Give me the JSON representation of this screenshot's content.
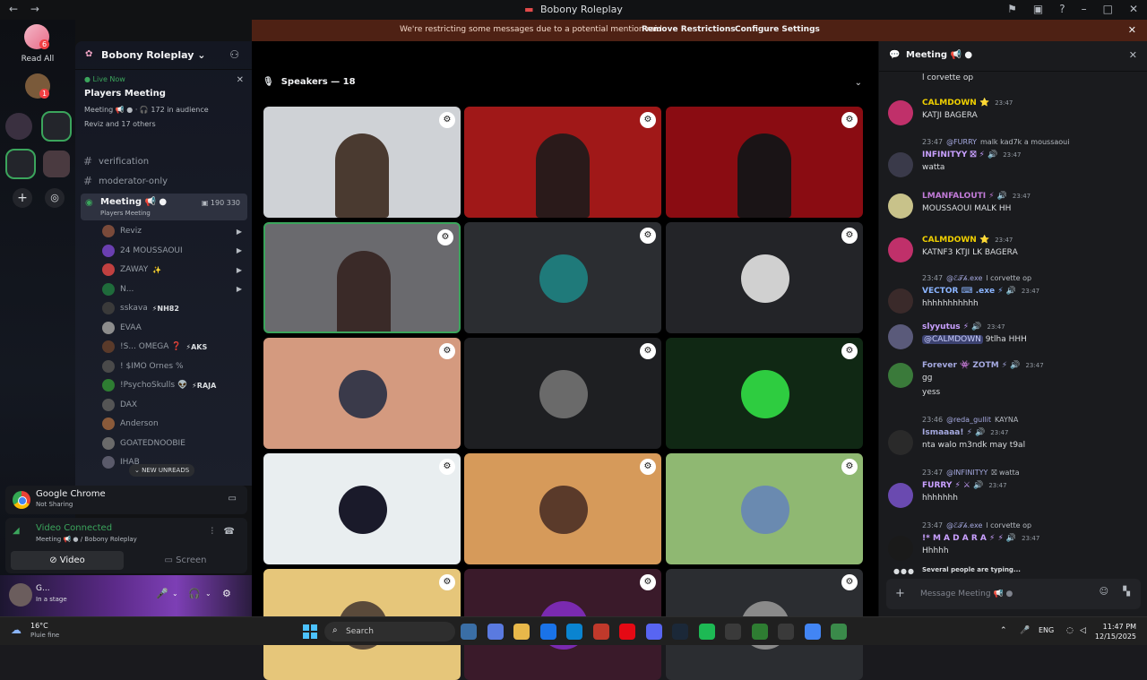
{
  "window": {
    "title": "Bobony Roleplay",
    "nav_back": "←",
    "nav_forward": "→",
    "tools": [
      "⚑",
      "▣",
      "?",
      "–",
      "□",
      "✕"
    ]
  },
  "rail": {
    "read_all_label": "Read All",
    "badges": [
      "6",
      "1"
    ]
  },
  "notice": {
    "message": "We're restricting some messages due to a potential mention raid",
    "link1": "Remove Restrictions",
    "link2": "Configure Settings"
  },
  "server": {
    "name": "Bobony Roleplay ⌄",
    "live": {
      "status": "● Live Now",
      "title": "Players Meeting",
      "sub": "Meeting 📢 ● · 🎧 172 in audience",
      "who": "Reviz and 17 others"
    },
    "channels": [
      "verification",
      "moderator-only"
    ],
    "active_channel": {
      "name": "Meeting 📢 ●",
      "sub": "Players Meeting",
      "counts": "▣ 190   330"
    },
    "voice_users": [
      {
        "name": "Reviz",
        "tag": "",
        "color": "#7a4a3a"
      },
      {
        "name": "24 MOUSSAOUI",
        "tag": "",
        "color": "#6a3fb0"
      },
      {
        "name": "ZAWAY",
        "tag": "✨",
        "color": "#c04040"
      },
      {
        "name": "N...",
        "tag": "",
        "color": "#1f6b3b"
      },
      {
        "name": "sskava",
        "tag": "⚡NH82",
        "color": "#3a3a3a"
      },
      {
        "name": "EVAA",
        "tag": "",
        "color": "#8d8d8d"
      },
      {
        "name": "!S... OMEGA ❓",
        "tag": "⚡AKS",
        "color": "#5a3a2a"
      },
      {
        "name": "! $IMO Ornes %",
        "tag": "",
        "color": "#4a4a4a"
      },
      {
        "name": "!PsychoSkulls 👽",
        "tag": "⚡RAJA",
        "color": "#2e7d32"
      },
      {
        "name": "DAX",
        "tag": "",
        "color": "#555"
      },
      {
        "name": "Anderson",
        "tag": "",
        "color": "#8a5a3a"
      },
      {
        "name": "GOATEDNOOBIE",
        "tag": "",
        "color": "#6a6a6a"
      },
      {
        "name": "IHAB",
        "tag": "",
        "color": "#5a5a6a"
      }
    ],
    "new_unreads": "⌄ NEW UNREADS"
  },
  "panels": {
    "chrome": {
      "title": "Google Chrome",
      "sub": "Not Sharing"
    },
    "voice": {
      "status": "Video Connected",
      "channel": "Meeting 📢 ● / Bobony Roleplay",
      "video_label": "Video",
      "screen_label": "Screen"
    },
    "user": {
      "name": "G...",
      "status": "In a stage"
    }
  },
  "stage": {
    "speakers_label": "Speakers — 18",
    "tiles": [
      {
        "type": "cam",
        "bg": "#cfd2d6",
        "person": "#4a3a30"
      },
      {
        "type": "cam",
        "bg": "#a01818",
        "person": "#2a1a1a"
      },
      {
        "type": "cam",
        "bg": "#8a0c12",
        "person": "#1a1416"
      },
      {
        "type": "cam",
        "bg": "#6a6a6e",
        "person": "#3a2a28",
        "speaking": true
      },
      {
        "type": "avatar",
        "bg": "#2b2d31",
        "av": "#1f7a7a"
      },
      {
        "type": "avatar",
        "bg": "#232428",
        "av": "#d0d0d0"
      },
      {
        "type": "avatar",
        "bg": "#d49a7f",
        "av": "#3a3a4a"
      },
      {
        "type": "avatar",
        "bg": "#1e1f22",
        "av": "#6a6a6a"
      },
      {
        "type": "avatar",
        "bg": "#102814",
        "av": "#2ecc40"
      },
      {
        "type": "avatar",
        "bg": "#e9eef0",
        "av": "#1a1a2a"
      },
      {
        "type": "avatar",
        "bg": "#d69a5a",
        "av": "#5a3a2a"
      },
      {
        "type": "avatar",
        "bg": "#8fb872",
        "av": "#6a8ab0"
      },
      {
        "type": "avatar",
        "bg": "#e6c67a",
        "av": "#5a4a3a"
      },
      {
        "type": "avatar",
        "bg": "#3a1a2a",
        "av": "#7a2ab0"
      },
      {
        "type": "avatar",
        "bg": "#2b2d31",
        "av": "#8a8a8a"
      }
    ]
  },
  "chat": {
    "title": "Meeting 📢 ●",
    "top_line": "l corvette op",
    "messages": [
      {
        "name": "CALMDOWN ⭐",
        "name_color": "#f0d000",
        "time": "23:47",
        "text": "KATJI BAGERA",
        "av": "#c0306a"
      },
      {
        "reply_user": "@FURRY",
        "reply_text": "malk kad7k a moussaoui",
        "reply_time": "23:47",
        "name": "INFINITYY ⛝ ⚡ 🔊",
        "name_color": "#c9a0ff",
        "time": "23:47",
        "text": "watta",
        "av": "#3a3a4a"
      },
      {
        "name": "LMANFALOUTI ⚡ 🔊",
        "name_color": "#c27bd8",
        "time": "23:47",
        "text": "MOUSSAOUI  MALK HH",
        "av": "#c8c28a"
      },
      {
        "name": "CALMDOWN ⭐",
        "name_color": "#f0d000",
        "time": "23:47",
        "text": "KATNF3 KTJI LK BAGERA",
        "av": "#c0306a"
      },
      {
        "reply_user": "@ℰ𝒯𝒽.exe",
        "reply_text": "l corvette op",
        "reply_time": "23:47",
        "name": "VECTOR ⌨ .exe ⚡ 🔊",
        "name_color": "#8ab4ff",
        "time": "23:47",
        "text": "hhhhhhhhhhh",
        "av": "#3a2a2a"
      },
      {
        "name": "slyyutus ⚡ 🔊",
        "name_color": "#c9a0ff",
        "time": "23:47",
        "text": "@CALMDOWN 9tlha HHH",
        "mention": "@CALMDOWN",
        "rest": " 9tlha HHH",
        "av": "#5a5a7a"
      },
      {
        "name": "Forever 👾 ZOTM ⚡ 🔊",
        "name_color": "#a5a9e0",
        "time": "23:47",
        "text": "gg",
        "text2": "yess",
        "av": "#3a7a3a"
      },
      {
        "reply_user": "@reda_gullit",
        "reply_text": "KAYNA",
        "reply_time": "23:46",
        "name": "Ismaaaa! ⚡ 🔊",
        "name_color": "#a5a9e0",
        "time": "23:47",
        "text": "nta walo m3ndk may t9al",
        "av": "#2a2a2a"
      },
      {
        "reply_user": "@INFINITYY",
        "reply_text": "⛝ watta",
        "reply_time": "23:47",
        "name": "FURRY ⚡ ⚔ 🔊",
        "name_color": "#c9a0ff",
        "time": "23:47",
        "text": "hhhhhhh",
        "av": "#6a4ab0"
      },
      {
        "reply_user": "@ℰ𝒯𝒽.exe",
        "reply_text": "l corvette op",
        "reply_time": "23:47",
        "name": "!* M A D A R A ⚡ ⚡ 🔊",
        "name_color": "#c9a0ff",
        "time": "23:47",
        "text": "Hhhhh",
        "av": "#1a1a1a"
      }
    ],
    "typing": "Several people are typing...",
    "composer_placeholder": "Message Meeting 📢 ●"
  },
  "taskbar": {
    "weather_temp": "16°C",
    "weather_desc": "Pluie fine",
    "search_placeholder": "Search",
    "lang": "ENG",
    "time": "11:47 PM",
    "date": "12/15/2025",
    "apps": [
      "#3a6ea5",
      "#5a7adf",
      "#e8b84a",
      "#1a73e8",
      "#0a84d0",
      "#c0392b",
      "#e50914",
      "#5865f2",
      "#1b2838",
      "#1db954",
      "#3a3a3a",
      "#2e7d32",
      "#3a3a3a",
      "#4285f4",
      "#3a8a4a"
    ]
  }
}
